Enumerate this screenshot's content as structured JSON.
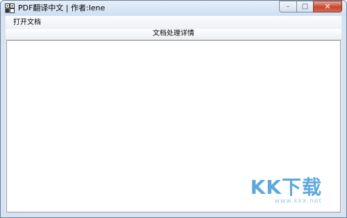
{
  "window": {
    "title": "PDF翻译中文 | 作者:lene",
    "controls": {
      "minimize": "–",
      "maximize": "□",
      "close": "✕"
    }
  },
  "menu": {
    "items": [
      {
        "label": "打开文档"
      }
    ]
  },
  "main": {
    "section_header": "文档处理详情",
    "details_text": ""
  },
  "watermark": {
    "logo": "KK下载",
    "url": "www.kkx.net"
  },
  "icons": {
    "app_icon": "app-logo-icon"
  }
}
